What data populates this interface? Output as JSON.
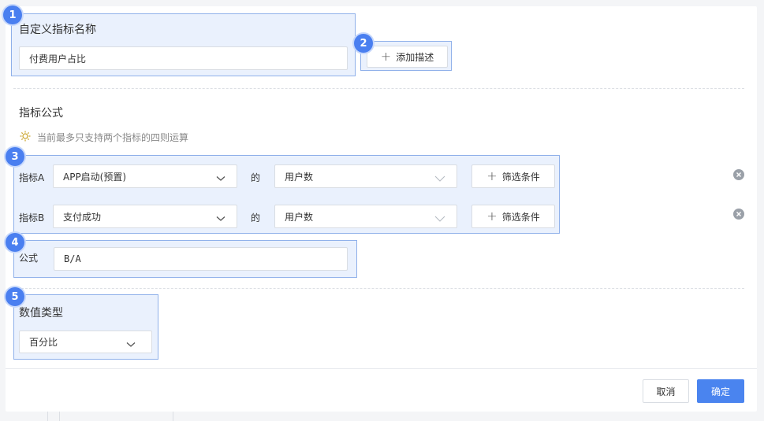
{
  "badges": [
    "1",
    "2",
    "3",
    "4",
    "5"
  ],
  "name_section": {
    "label": "自定义指标名称",
    "value": "付费用户占比"
  },
  "add_desc_label": "添加描述",
  "formula_section": {
    "title": "指标公式",
    "hint": "当前最多只支持两个指标的四则运算",
    "metrics": [
      {
        "label": "指标A",
        "event": "APP启动(预置)",
        "connector": "的",
        "measure": "用户数",
        "filter_label": "筛选条件"
      },
      {
        "label": "指标B",
        "event": "支付成功",
        "connector": "的",
        "measure": "用户数",
        "filter_label": "筛选条件"
      }
    ],
    "formula_label": "公式",
    "formula_value": "B/A"
  },
  "value_type": {
    "label": "数值类型",
    "selected": "百分比"
  },
  "footer": {
    "cancel": "取消",
    "confirm": "确定"
  },
  "colors": {
    "accent": "#4a84ef",
    "highlight_bg": "#eaf1fd",
    "highlight_border": "#8fb0ea"
  }
}
